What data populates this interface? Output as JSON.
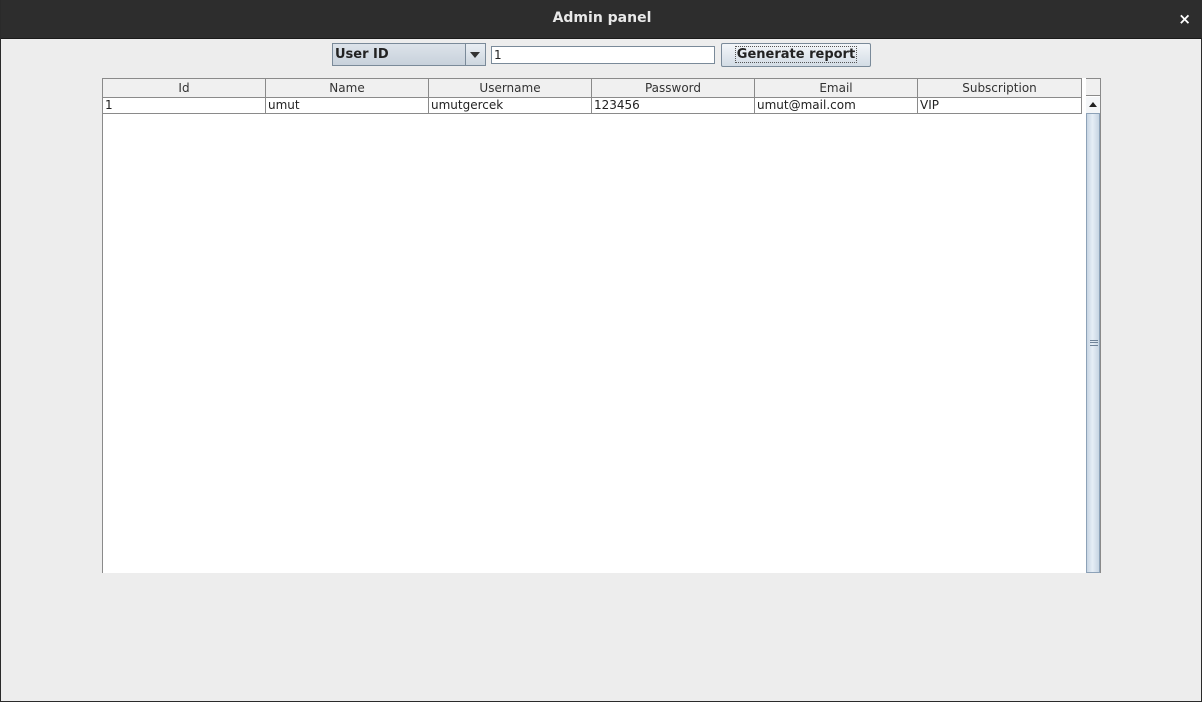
{
  "window": {
    "title": "Admin panel",
    "close_glyph": "×"
  },
  "toolbar": {
    "search_field_select": {
      "selected": "User ID"
    },
    "search_value": "1",
    "generate_button_label": "Generate report"
  },
  "table": {
    "columns": [
      "Id",
      "Name",
      "Username",
      "Password",
      "Email",
      "Subscription"
    ],
    "rows": [
      [
        "1",
        "umut",
        "umutgercek",
        "123456",
        "umut@mail.com",
        "VIP"
      ]
    ]
  },
  "colors": {
    "titlebar": "#2d2d2d",
    "window_bg": "#ededed",
    "scroll_thumb": "#c7d5e3"
  }
}
